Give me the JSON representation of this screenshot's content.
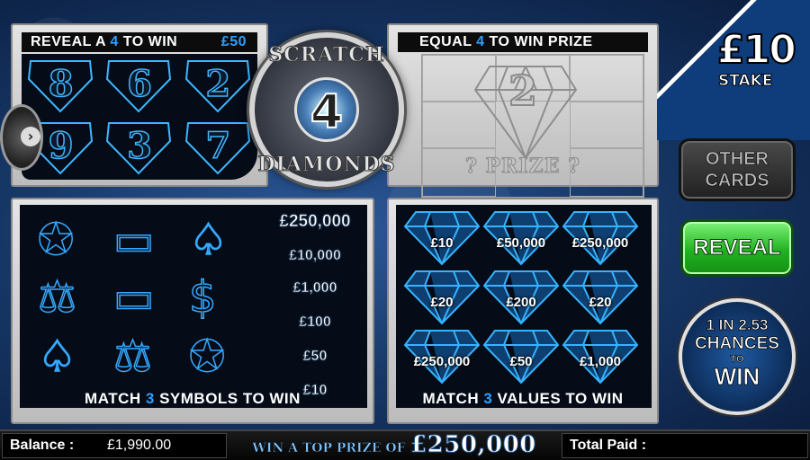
{
  "reveal_panel": {
    "title_pre": "REVEAL A ",
    "title_num": "4",
    "title_post": " TO WIN",
    "prize": "£50",
    "numbers": [
      "8",
      "6",
      "2",
      "9",
      "3",
      "7"
    ]
  },
  "logo": {
    "top": "SCRATCH",
    "center": "4",
    "bottom": "DIAMONDS"
  },
  "equal_panel": {
    "title_pre": "EQUAL ",
    "title_num": "4",
    "title_post": " TO WIN PRIZE",
    "revealed_number": "2",
    "prize_label": "? PRIZE ?"
  },
  "symbols_panel": {
    "symbols": [
      "compass",
      "card",
      "spade-card",
      "scales",
      "card",
      "dollar",
      "spade-card",
      "scales",
      "compass"
    ],
    "prize_ladder": [
      "£250,000",
      "£10,000",
      "£1,000",
      "£100",
      "£50",
      "£10"
    ],
    "footer_pre": "MATCH ",
    "footer_num": "3",
    "footer_post": " SYMBOLS TO WIN"
  },
  "values_panel": {
    "values": [
      "£10",
      "£50,000",
      "£250,000",
      "£20",
      "£200",
      "£20",
      "£250,000",
      "£50",
      "£1,000"
    ],
    "footer_pre": "MATCH ",
    "footer_num": "3",
    "footer_post": " VALUES TO WIN"
  },
  "stake": {
    "amount": "£10",
    "label": "STAKE"
  },
  "buttons": {
    "other_line1": "OTHER",
    "other_line2": "CARDS",
    "reveal": "REVEAL"
  },
  "odds": {
    "line1": "1 IN 2.53",
    "line2": "CHANCES",
    "line3": "TO",
    "line4": "WIN"
  },
  "bottom_bar": {
    "balance_label": "Balance :",
    "balance_value": "£1,990.00",
    "top_prize_text": "WIN A TOP PRIZE OF",
    "top_prize_amount": "£250,000",
    "total_paid_label": "Total Paid :"
  },
  "colors": {
    "accent_blue": "#2ea0ff",
    "reveal_green": "#22b222"
  }
}
